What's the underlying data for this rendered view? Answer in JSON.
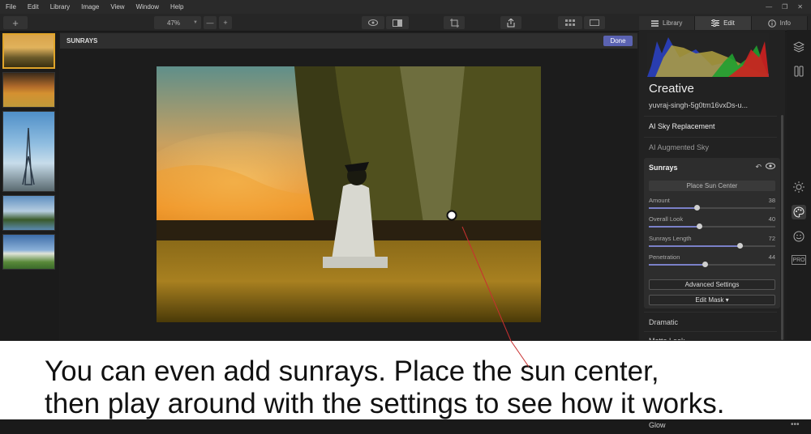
{
  "menu": [
    "File",
    "Edit",
    "Library",
    "Image",
    "View",
    "Window",
    "Help"
  ],
  "toolbar": {
    "zoom": "47%",
    "zoom_minus": "—",
    "zoom_plus": "+",
    "add": "+"
  },
  "panel_tabs": [
    {
      "label": "Library",
      "icon": "library-icon"
    },
    {
      "label": "Edit",
      "icon": "sliders-icon"
    },
    {
      "label": "Info",
      "icon": "info-icon"
    }
  ],
  "edit_header": {
    "title": "SUNRAYS",
    "done_label": "Done"
  },
  "right_panel": {
    "title": "Creative",
    "file_name": "yuvraj-singh-5g0tm16vxDs-u...",
    "sections_above": [
      "AI Sky Replacement",
      "AI Augmented Sky"
    ],
    "sunrays": {
      "title": "Sunrays",
      "place_label": "Place Sun Center",
      "sliders": [
        {
          "label": "Amount",
          "value": 38
        },
        {
          "label": "Overall Look",
          "value": 40
        },
        {
          "label": "Sunrays Length",
          "value": 72
        },
        {
          "label": "Penetration",
          "value": 44
        }
      ],
      "advanced_label": "Advanced Settings",
      "mask_label": "Edit Mask ▾"
    },
    "sections_below": [
      "Dramatic",
      "Matte Look"
    ],
    "glow_label": "Glow"
  },
  "caption": {
    "line1": "You can even add sunrays. Place the sun center,",
    "line2": "then play around with the settings to see how it works."
  },
  "colors": {
    "accent": "#5b63b2",
    "selection": "#e0a52a"
  }
}
